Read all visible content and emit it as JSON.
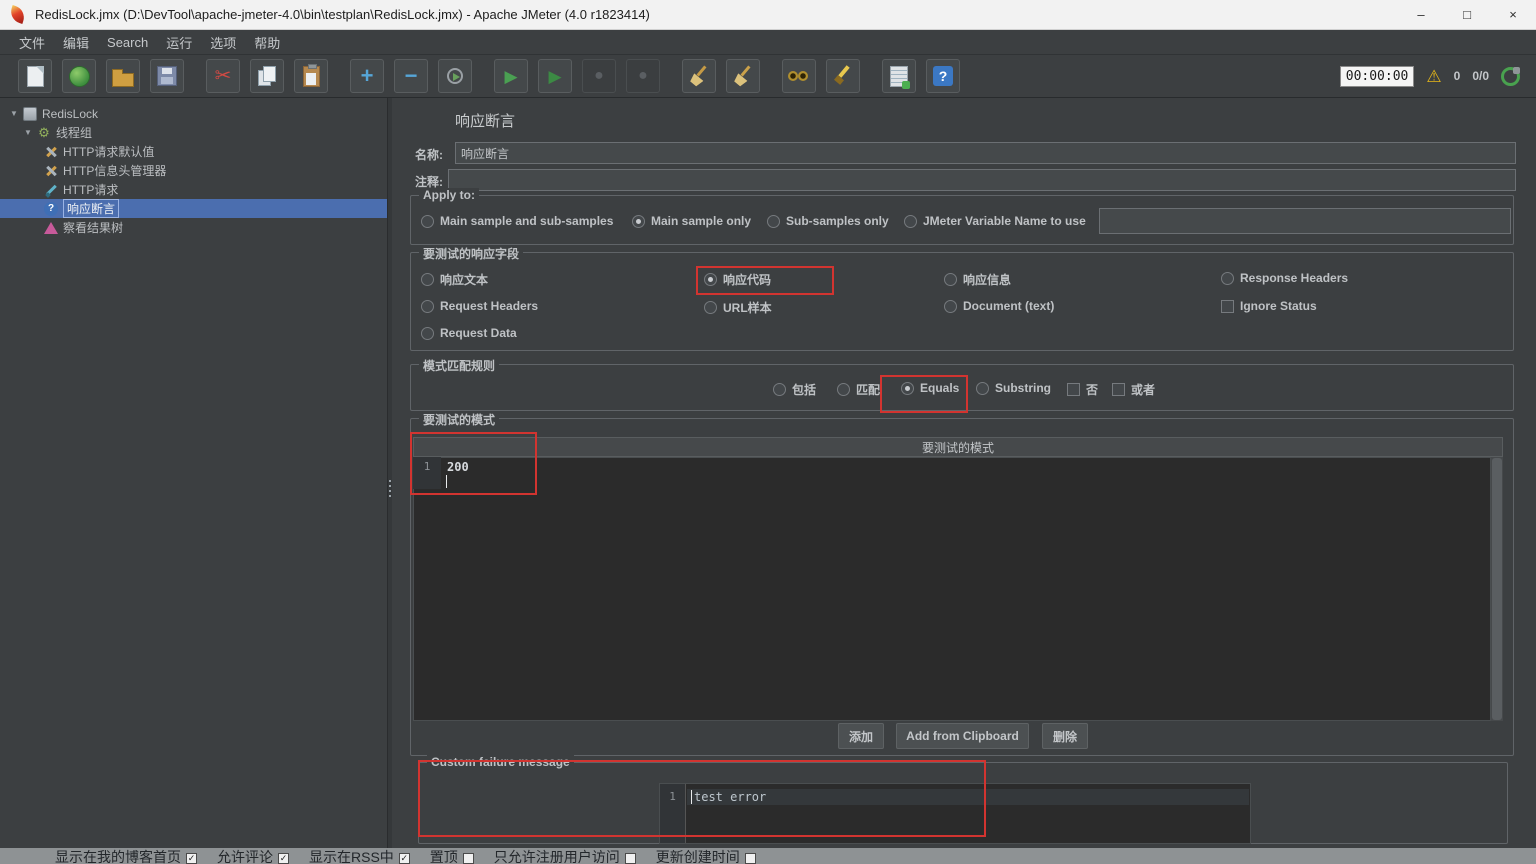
{
  "window": {
    "title": "RedisLock.jmx (D:\\DevTool\\apache-jmeter-4.0\\bin\\testplan\\RedisLock.jmx) - Apache JMeter (4.0 r1823414)",
    "minimize": "–",
    "maximize": "□",
    "close": "×"
  },
  "menu": {
    "file": "文件",
    "edit": "编辑",
    "search": "Search",
    "run": "运行",
    "options": "选项",
    "help": "帮助"
  },
  "toolbar": {
    "timer": "00:00:00",
    "warning_count": "0",
    "threads": "0/0"
  },
  "icons": {
    "cut": "✂",
    "add": "+",
    "remove": "−",
    "start": "▶",
    "start_no_pauses": "▶",
    "stop": "●",
    "shutdown": "●",
    "warning": "⚠",
    "help": "?",
    "tree_expand": "▼",
    "gear": "⚙",
    "question": "?"
  },
  "tree": {
    "root": "RedisLock",
    "thread_group": "线程组",
    "http_defaults": "HTTP请求默认值",
    "header_manager": "HTTP信息头管理器",
    "http_request": "HTTP请求",
    "assertion": "响应断言",
    "results_tree": "察看结果树"
  },
  "panel": {
    "title": "响应断言",
    "name_label": "名称:",
    "name_value": "响应断言",
    "comment_label": "注释:",
    "comment_value": "",
    "apply": {
      "title": "Apply to:",
      "main_and_sub": "Main sample and sub-samples",
      "main_only": "Main sample only",
      "sub_only": "Sub-samples only",
      "jmeter_var": "JMeter Variable Name to use",
      "variable_value": ""
    },
    "field": {
      "title": "要测试的响应字段",
      "response_text": "响应文本",
      "response_code": "响应代码",
      "response_message": "响应信息",
      "response_headers": "Response Headers",
      "request_headers": "Request Headers",
      "url_sample": "URL样本",
      "document_text": "Document (text)",
      "ignore_status": "Ignore Status",
      "request_data": "Request Data"
    },
    "rules": {
      "title": "模式匹配规则",
      "contains": "包括",
      "matches": "匹配",
      "equals": "Equals",
      "substring": "Substring",
      "not": "否",
      "or": "或者"
    },
    "patterns": {
      "title": "要测试的模式",
      "header": "要测试的模式",
      "row_number": "1",
      "row_value": "200",
      "add": "添加",
      "add_from_clipboard": "Add from Clipboard",
      "delete": "删除"
    },
    "custom": {
      "title": "Custom failure message",
      "line_number": "1",
      "text": "test error"
    }
  },
  "taskbar": {
    "item1": "显示在我的博客首页",
    "item2": "允许评论",
    "item3": "显示在RSS中",
    "item4": "置顶",
    "item5": "只允许注册用户访问",
    "item6": "更新创建时间"
  }
}
